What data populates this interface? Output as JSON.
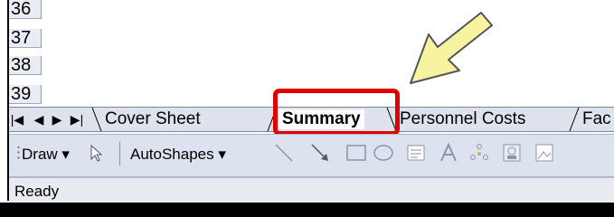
{
  "rows": [
    "36",
    "37",
    "38",
    "39"
  ],
  "sheet_tabs": {
    "nav": [
      "first-sheet",
      "prev-sheet",
      "next-sheet",
      "last-sheet"
    ],
    "tabs": [
      {
        "label": "Cover Sheet",
        "active": false
      },
      {
        "label": "Summary",
        "active": true
      },
      {
        "label": "Personnel Costs",
        "active": false
      },
      {
        "label": "Fac",
        "active": false
      }
    ]
  },
  "drawing_toolbar": {
    "draw_label": "Draw",
    "autoshapes_label": "AutoShapes"
  },
  "status_bar": {
    "text": "Ready"
  },
  "colors": {
    "highlight": "#e00000",
    "arrow_fill": "#f7f3a0",
    "arrow_stroke": "#555555"
  }
}
